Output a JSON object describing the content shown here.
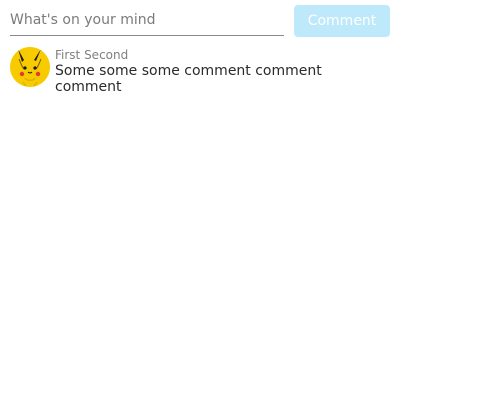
{
  "composer": {
    "input_value": "",
    "input_placeholder": "What's on your mind",
    "submit_label": "Comment"
  },
  "comments": [
    {
      "author": "First Second",
      "text": "Some some some comment comment comment",
      "avatar_icon": "pikachu-avatar-icon"
    }
  ],
  "colors": {
    "button_background": "#bde9fb",
    "button_text": "#ffffff",
    "avatar_yellow": "#f7cb00"
  }
}
